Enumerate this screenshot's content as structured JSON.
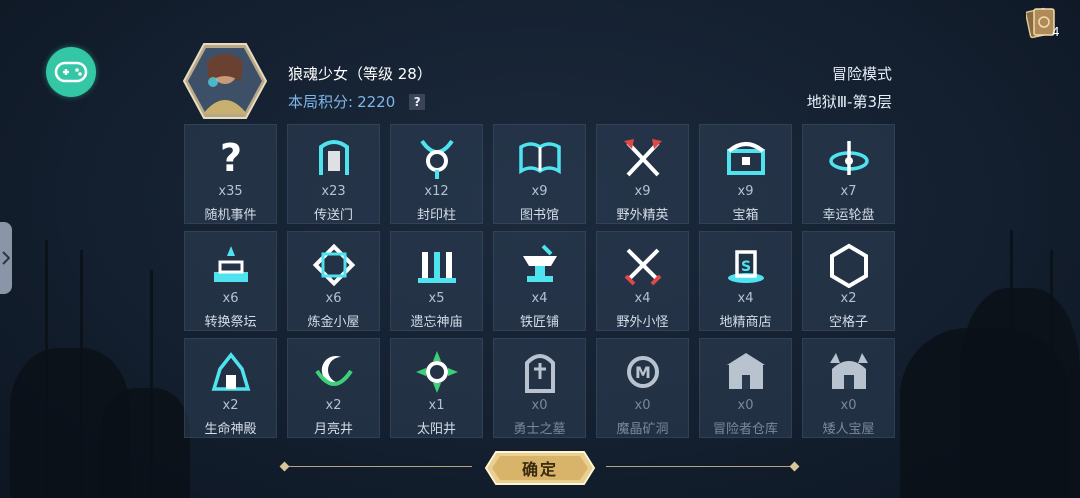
{
  "player": {
    "name": "狼魂少女（等级 28）",
    "score_label": "本局积分:",
    "score_value": "2220",
    "help_label": "?"
  },
  "mode": {
    "title": "冒险模式",
    "level": "地狱Ⅲ-第3层"
  },
  "cards_count": "4",
  "tiles": [
    {
      "count": "x35",
      "label": "随机事件",
      "icon": "question-mark-icon"
    },
    {
      "count": "x23",
      "label": "传送门",
      "icon": "portal-icon"
    },
    {
      "count": "x12",
      "label": "封印柱",
      "icon": "seal-pillar-icon"
    },
    {
      "count": "x9",
      "label": "图书馆",
      "icon": "book-icon"
    },
    {
      "count": "x9",
      "label": "野外精英",
      "icon": "crossed-axes-icon"
    },
    {
      "count": "x9",
      "label": "宝箱",
      "icon": "treasure-chest-icon"
    },
    {
      "count": "x7",
      "label": "幸运轮盘",
      "icon": "wheel-icon"
    },
    {
      "count": "x6",
      "label": "转换祭坛",
      "icon": "altar-icon"
    },
    {
      "count": "x6",
      "label": "炼金小屋",
      "icon": "alchemy-icon"
    },
    {
      "count": "x5",
      "label": "遗忘神庙",
      "icon": "temple-icon"
    },
    {
      "count": "x4",
      "label": "铁匠铺",
      "icon": "anvil-icon"
    },
    {
      "count": "x4",
      "label": "野外小怪",
      "icon": "crossed-swords-icon"
    },
    {
      "count": "x4",
      "label": "地精商店",
      "icon": "goblin-shop-icon"
    },
    {
      "count": "x2",
      "label": "空格子",
      "icon": "hexagon-icon"
    },
    {
      "count": "x2",
      "label": "生命神殿",
      "icon": "life-shrine-icon"
    },
    {
      "count": "x2",
      "label": "月亮井",
      "icon": "moon-well-icon"
    },
    {
      "count": "x1",
      "label": "太阳井",
      "icon": "sun-well-icon"
    },
    {
      "count": "x0",
      "label": "勇士之墓",
      "icon": "tombstone-icon"
    },
    {
      "count": "x0",
      "label": "魔晶矿洞",
      "icon": "mine-icon"
    },
    {
      "count": "x0",
      "label": "冒险者仓库",
      "icon": "warehouse-icon"
    },
    {
      "count": "x0",
      "label": "矮人宝屋",
      "icon": "dwarf-house-icon"
    }
  ],
  "confirm_label": "确定",
  "colors": {
    "accent_cyan": "#4fe3f0",
    "gamepad_green": "#34c7a6",
    "score_blue": "#7fb6e8",
    "gold": "#d8c59a"
  }
}
